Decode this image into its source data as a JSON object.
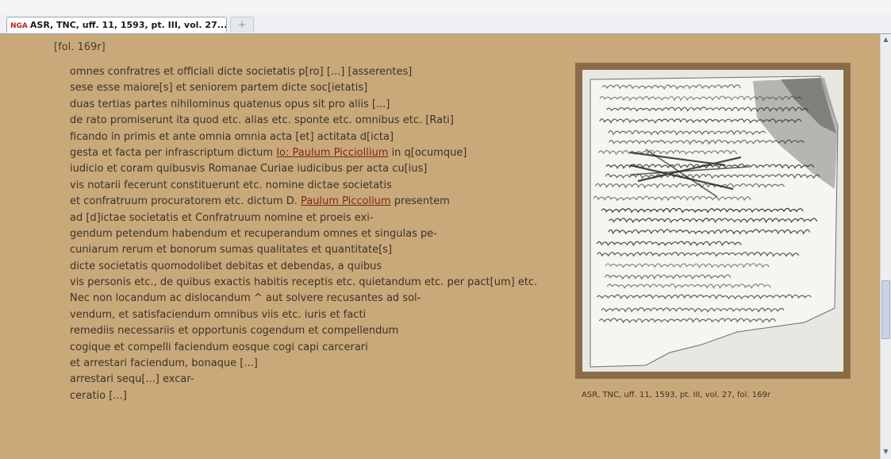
{
  "tab": {
    "badge": "NGA",
    "title": "ASR, TNC, uff. 11, 1593, pt. III, vol. 27...",
    "new_tab_glyph": "+"
  },
  "document": {
    "folio": "[fol. 169r]",
    "lines": [
      "omnes confratres et officiali dicte societatis p[ro] [...] [asserentes]",
      "sese esse maiore[s] et seniorem partem dicte soc[ietatis]",
      "duas tertias partes nihilominus quatenus opus sit pro aliis [...]",
      "de rato promiserunt ita quod etc. alias etc. sponte etc. omnibus etc. [Rati]",
      "ficando in primis et ante omnia omnia acta [et] actitata d[icta]",
      "gesta et facta per infrascriptum dictum Io: Paulum Picciollium in q[ocumque]",
      "iudicio et coram quibusvis Romanae Curiae iudicibus per acta cu[ius]",
      "vis notarii fecerunt constituerunt etc. nomine dictae societatis",
      "et confratruum procuratorem etc. dictum D. Paulum Piccolium presentem",
      "ad [d]ictae societatis et Confratruum nomine et proeis exi-",
      "gendum petendum habendum et recuperandum omnes et singulas pe-",
      "cuniarum rerum et bonorum sumas qualitates et quantitate[s]",
      "dicte societatis quomodolibet debitas et debendas, a quibus",
      "vis personis etc., de quibus exactis habitis receptis etc. quietandum etc. per pact[um] etc.",
      "Nec non locandum ac dislocandum ^ aut solvere recusantes ad sol-",
      "vendum, et satisfaciendum omnibus viis etc. iuris et facti",
      "remediis necessariis et opportunis cogendum et compellendum",
      "cogique et compelli faciendum eosque cogi capi carcerari",
      "et arrestari faciendum, bonaque [...]",
      "arrestari sequ[...] excar-",
      "ceratio [...]"
    ],
    "link_lines": [
      5,
      8
    ]
  },
  "image": {
    "caption": "ASR, TNC, uff. 11, 1593, pt. III, vol. 27, fol. 169r"
  },
  "scrollbar": {
    "up": "▲",
    "down": "▼"
  },
  "colors": {
    "page_bg": "#c9a97a",
    "link": "#7a2a10",
    "text": "#3b3228"
  }
}
